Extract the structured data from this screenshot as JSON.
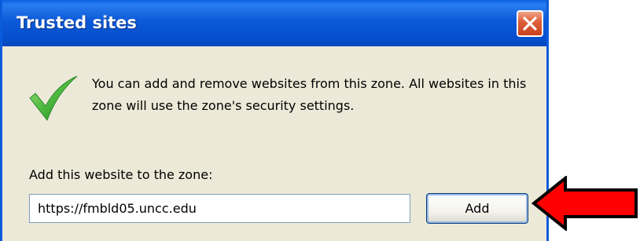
{
  "window": {
    "title": "Trusted sites",
    "close_icon": "close-x-icon"
  },
  "content": {
    "icon": "green-checkmark-icon",
    "description": "You can add and remove websites from this zone. All websites in this zone will use the zone's security settings.",
    "add_label": "Add this website to the zone:",
    "url_value": "https://fmbld05.uncc.edu",
    "add_button_label": "Add"
  },
  "annotation": {
    "icon": "red-arrow-left-icon",
    "color": "#ff0000"
  },
  "colors": {
    "titlebar": "#0b59d8",
    "dialog_bg": "#ece9d8",
    "close_button": "#e0603a",
    "check": "#3aa83a"
  }
}
